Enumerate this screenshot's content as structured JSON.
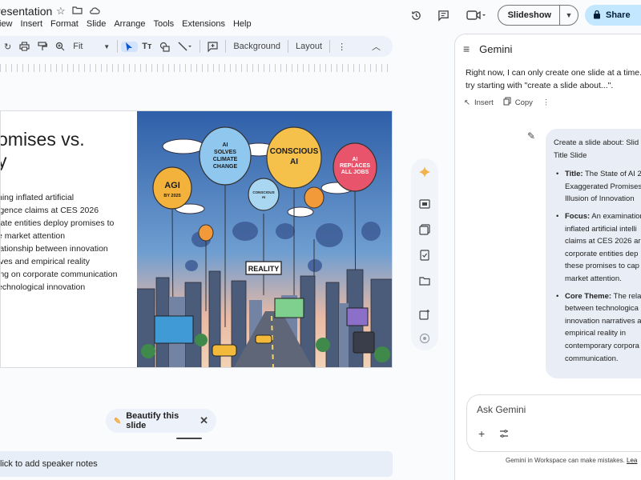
{
  "app": {
    "doc_title": "resentation",
    "menu": [
      "iew",
      "Insert",
      "Format",
      "Slide",
      "Arrange",
      "Tools",
      "Extensions",
      "Help"
    ]
  },
  "header": {
    "slideshow_label": "Slideshow",
    "share_label": "Share"
  },
  "toolbar": {
    "zoom_value": "Fit",
    "background_label": "Background",
    "layout_label": "Layout"
  },
  "slide": {
    "title_lines": [
      "omises vs.",
      "y"
    ],
    "body_lines": [
      "ning inflated artificial",
      "igence claims at CES 2026",
      "rate entities deploy promises to",
      "e market attention",
      "lationship between innovation",
      "ives and empirical reality",
      "ing on corporate communication",
      "echnological innovation"
    ],
    "image_labels": {
      "agi": "AGI",
      "agi_sub": "BY 2025",
      "climate": "AI SOLVES CLIMATE CHANGE",
      "conscious": "CONSCIOUS AI",
      "conscious_small": "CONSCIOUS AI",
      "jobs": "AI REPLACES ALL JOBS",
      "reality": "REALITY"
    }
  },
  "beautify": {
    "label": "Beautify this slide"
  },
  "notes": {
    "placeholder": "lick to add speaker notes"
  },
  "gemini": {
    "title": "Gemini",
    "prev_line1": "Right now, I can only create one slide at a time. Fo",
    "prev_line2": "try starting with \"create a slide about...\".",
    "insert_label": "Insert",
    "copy_label": "Copy",
    "prompt_line1": "Create a slide about: Slid",
    "prompt_line2": "Title Slide",
    "bullets": [
      {
        "label": "Title:",
        "lines": [
          " The State of AI 2",
          "Exaggerated Promises",
          "Illusion of Innovation"
        ]
      },
      {
        "label": "Focus:",
        "lines": [
          " An examination",
          "inflated artificial intelli",
          "claims at CES 2026 ar",
          "corporate entities dep",
          "these promises to cap",
          "market attention."
        ]
      },
      {
        "label": "Core Theme:",
        "lines": [
          " The rela",
          "between technologica",
          "innovation narratives a",
          "empirical reality in",
          "contemporary corpora",
          "communication."
        ]
      }
    ],
    "ask_placeholder": "Ask Gemini",
    "disclaimer": "Gemini in Workspace can make mistakes.",
    "disclaimer_link": "Lea"
  },
  "colors": {
    "accent_blue": "#c2e7ff",
    "arrow_red": "#e53935",
    "panel_bg": "#ffffff",
    "bubble_bg": "#e9eef6"
  }
}
